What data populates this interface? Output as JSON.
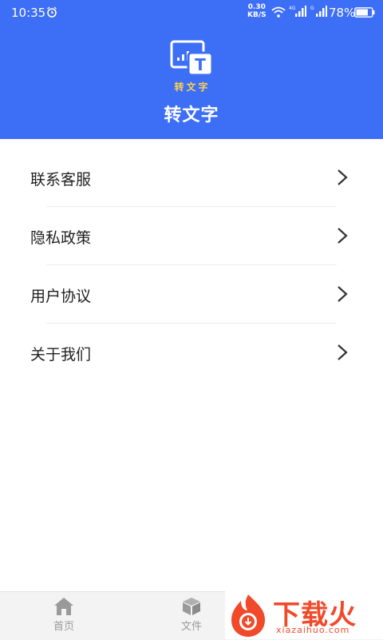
{
  "status": {
    "time": "10:35",
    "net_speed_value": "0.30",
    "net_speed_unit": "KB/S",
    "battery_percent": "78%",
    "battery_level": 0.78,
    "signal1_tag": "4G",
    "signal2_tag": "G",
    "icons": [
      "alarm-icon",
      "wifi-icon",
      "signal-icon",
      "signal-icon",
      "battery-icon"
    ]
  },
  "header": {
    "logo_text": "转文字",
    "logo_letter": "T",
    "title": "转文字",
    "bg_color": "#3d6ef6"
  },
  "menu": {
    "items": [
      {
        "label": "联系客服"
      },
      {
        "label": "隐私政策"
      },
      {
        "label": "用户协议"
      },
      {
        "label": "关于我们"
      }
    ]
  },
  "tabbar": {
    "tabs": [
      {
        "label": "首页",
        "icon": "home-icon"
      },
      {
        "label": "文件",
        "icon": "box-icon"
      }
    ]
  },
  "watermark": {
    "text": "下载火",
    "url": "xiazaihuo.com",
    "color": "#f04a2a"
  }
}
